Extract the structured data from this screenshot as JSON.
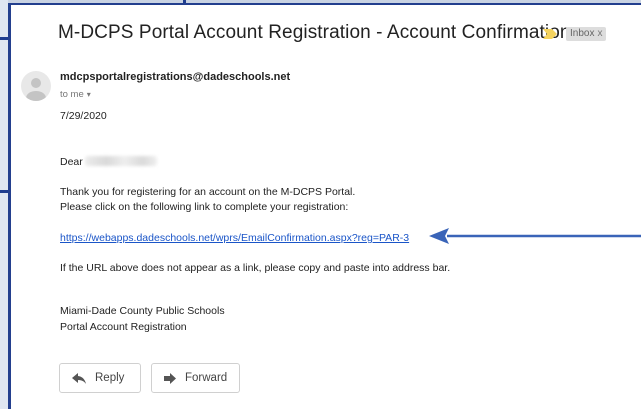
{
  "email": {
    "subject": "M-DCPS Portal Account Registration - Account Confirmation",
    "label": "Inbox",
    "label_close": "x",
    "sender": "mdcpsportalregistrations@dadeschools.net",
    "recipient": "to me",
    "date": "7/29/2020",
    "greeting": "Dear",
    "body_line_1": "Thank you for registering for an account on the M-DCPS Portal.",
    "body_line_2": "Please click on the following link to complete your registration:",
    "link": "https://webapps.dadeschools.net/wprs/EmailConfirmation.aspx?reg=PAR-3",
    "body_line_3": "If the URL above does not appear as a link, please copy and paste into address bar.",
    "signature_line_1": "Miami-Dade County Public Schools",
    "signature_line_2": "Portal Account Registration"
  },
  "actions": {
    "reply": "Reply",
    "forward": "Forward"
  },
  "icons": {
    "importance": "importance-marker-icon",
    "avatar": "default-avatar-icon",
    "reply": "reply-arrow-icon",
    "forward": "forward-arrow-icon",
    "annotation": "annotation-arrow-icon"
  },
  "colors": {
    "frame_border": "#233f8e",
    "link": "#1a55c8",
    "annotation_arrow": "#3a64b8",
    "importance": "#f4d35e"
  }
}
